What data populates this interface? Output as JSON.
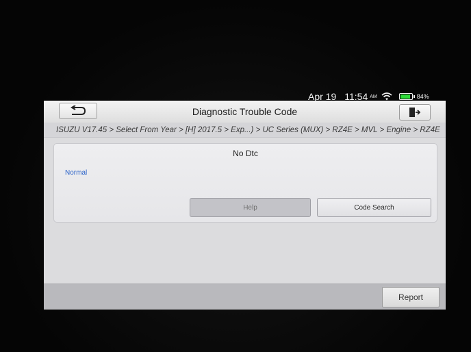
{
  "status_bar": {
    "date": "Apr 19",
    "time": "11:54",
    "ampm": "AM",
    "battery_percent": "84%",
    "battery_level": 0.84,
    "battery_color": "#2fdc3a"
  },
  "header": {
    "title": "Diagnostic Trouble Code",
    "back_icon": "back-arrow-icon",
    "exit_icon": "exit-door-icon"
  },
  "breadcrumb": "ISUZU V17.45 > Select From Year > [H] 2017.5 > Exp...) > UC Series (MUX) > RZ4E > MVL > Engine > RZ4E",
  "panel": {
    "message": "No Dtc",
    "status": "Normal",
    "status_color": "#2c63c9",
    "help_label": "Help",
    "code_search_label": "Code Search"
  },
  "footer": {
    "report_label": "Report"
  }
}
